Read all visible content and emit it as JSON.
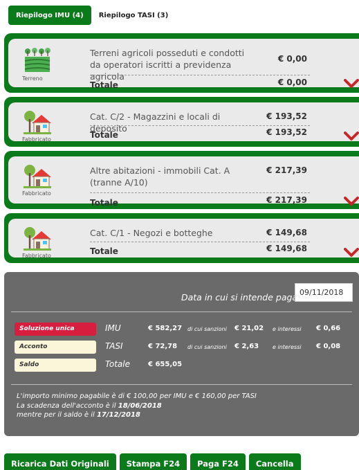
{
  "tabs": [
    {
      "label": "Riepilogo IMU (4)"
    },
    {
      "label": "Riepilogo TASI (3)"
    }
  ],
  "cards": [
    {
      "icon": "farm-field-icon",
      "icon_label": "Terreno",
      "description": "Terreni agricoli posseduti e condotti da operatori iscritti a previdenza agricola",
      "amount": "€ 0,00",
      "total_label": "Totale",
      "total": "€ 0,00"
    },
    {
      "icon": "house-tree-icon",
      "icon_label": "Fabbricato",
      "description": "Cat. C/2 - Magazzini e locali di deposito",
      "amount": "€ 193,52",
      "total_label": "Totale",
      "total": "€ 193,52"
    },
    {
      "icon": "house-tree-icon",
      "icon_label": "Fabbricato",
      "description": "Altre abitazioni - immobili Cat. A (tranne A/10)",
      "amount": "€ 217,39",
      "total_label": "Totale",
      "total": "€ 217,39"
    },
    {
      "icon": "house-tree-icon",
      "icon_label": "Fabbricato",
      "description": "Cat. C/1 - Negozi e botteghe",
      "amount": "€ 149,68",
      "total_label": "Totale",
      "total": "€ 149,68"
    }
  ],
  "summary": {
    "date_label": "Data in cui si intende pagare",
    "date_value": "09/11/2018",
    "options": [
      {
        "label": "Soluzione unica",
        "selected": true
      },
      {
        "label": "Acconto",
        "selected": false
      },
      {
        "label": "Saldo",
        "selected": false
      }
    ],
    "rows": [
      {
        "label": "IMU",
        "amount": "€ 582,27",
        "sanzioni_label": "di cui sanzioni",
        "sanzioni": "€ 21,02",
        "interessi_label": "e interessi",
        "interessi": "€ 0,66"
      },
      {
        "label": "TASI",
        "amount": "€ 72,78",
        "sanzioni_label": "di cui sanzioni",
        "sanzioni": "€ 2,63",
        "interessi_label": "e interessi",
        "interessi": "€ 0,08"
      },
      {
        "label": "Totale",
        "amount": "€ 655,05"
      }
    ],
    "notes": {
      "line1": "L'importo minimo pagabile è di € 100,00 per IMU e € 160,00 per TASI",
      "line2_prefix": "La scadenza dell'acconto è il ",
      "line2_date": "18/06/2018",
      "line3_prefix": "mentre per il saldo è il ",
      "line3_date": "17/12/2018"
    }
  },
  "buttons": {
    "reload": "Ricarica Dati Originali",
    "print": "Stampa F24",
    "pay": "Paga F24",
    "cancel": "Cancella"
  },
  "colors": {
    "brand_green": "#0b7a1a",
    "selected_option": "#d81e3e",
    "panel_gray": "#6a6a6a",
    "chevron_red": "#c62828"
  }
}
